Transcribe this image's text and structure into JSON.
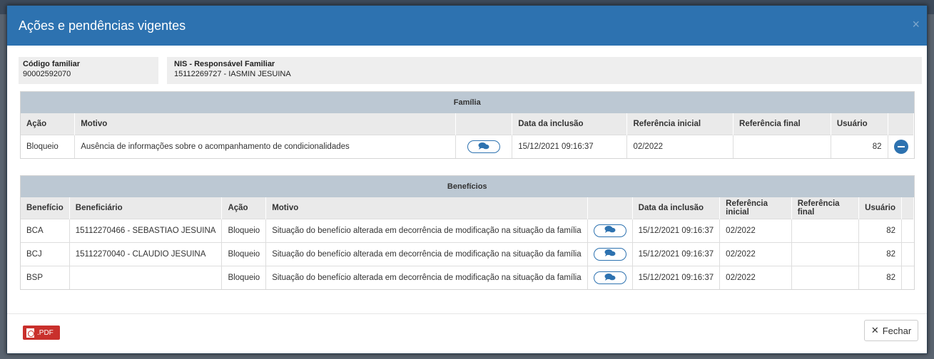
{
  "modal": {
    "title": "Ações e pendências vigentes",
    "close_glyph": "×"
  },
  "info": {
    "code_label": "Código familiar",
    "code_value": "90002592070",
    "nis_label": "NIS - Responsável Familiar",
    "nis_value": "15112269727 - IASMIN JESUINA"
  },
  "familia": {
    "section_title": "Família",
    "headers": [
      "Ação",
      "Motivo",
      "",
      "Data da inclusão",
      "Referência inicial",
      "Referência final",
      "Usuário",
      ""
    ],
    "rows": [
      {
        "acao": "Bloqueio",
        "motivo": "Ausência de informações sobre o acompanhamento de condicionalidades",
        "data_inclusao": "15/12/2021 09:16:37",
        "ref_inicial": "02/2022",
        "ref_final": "",
        "usuario": "82"
      }
    ]
  },
  "beneficios": {
    "section_title": "Benefícios",
    "headers": [
      "Benefício",
      "Beneficiário",
      "Ação",
      "Motivo",
      "",
      "Data da inclusão",
      "Referência inicial",
      "Referência final",
      "Usuário",
      ""
    ],
    "rows": [
      {
        "beneficio": "BCA",
        "beneficiario": "15112270466 - SEBASTIAO JESUINA",
        "acao": "Bloqueio",
        "motivo": "Situação do benefício alterada em decorrência de modificação na situação da família",
        "data_inclusao": "15/12/2021 09:16:37",
        "ref_inicial": "02/2022",
        "ref_final": "",
        "usuario": "82"
      },
      {
        "beneficio": "BCJ",
        "beneficiario": "15112270040 - CLAUDIO JESUINA",
        "acao": "Bloqueio",
        "motivo": "Situação do benefício alterada em decorrência de modificação na situação da família",
        "data_inclusao": "15/12/2021 09:16:37",
        "ref_inicial": "02/2022",
        "ref_final": "",
        "usuario": "82"
      },
      {
        "beneficio": "BSP",
        "beneficiario": "",
        "acao": "Bloqueio",
        "motivo": "Situação do benefício alterada em decorrência de modificação na situação da família",
        "data_inclusao": "15/12/2021 09:16:37",
        "ref_inicial": "02/2022",
        "ref_final": "",
        "usuario": "82"
      }
    ]
  },
  "footer": {
    "pdf_label": ".PDF",
    "close_label": "Fechar",
    "close_glyph": "✕"
  },
  "colors": {
    "header_blue": "#2d72b0",
    "section_head": "#bcc8d3",
    "pdf_red": "#c9302c"
  }
}
